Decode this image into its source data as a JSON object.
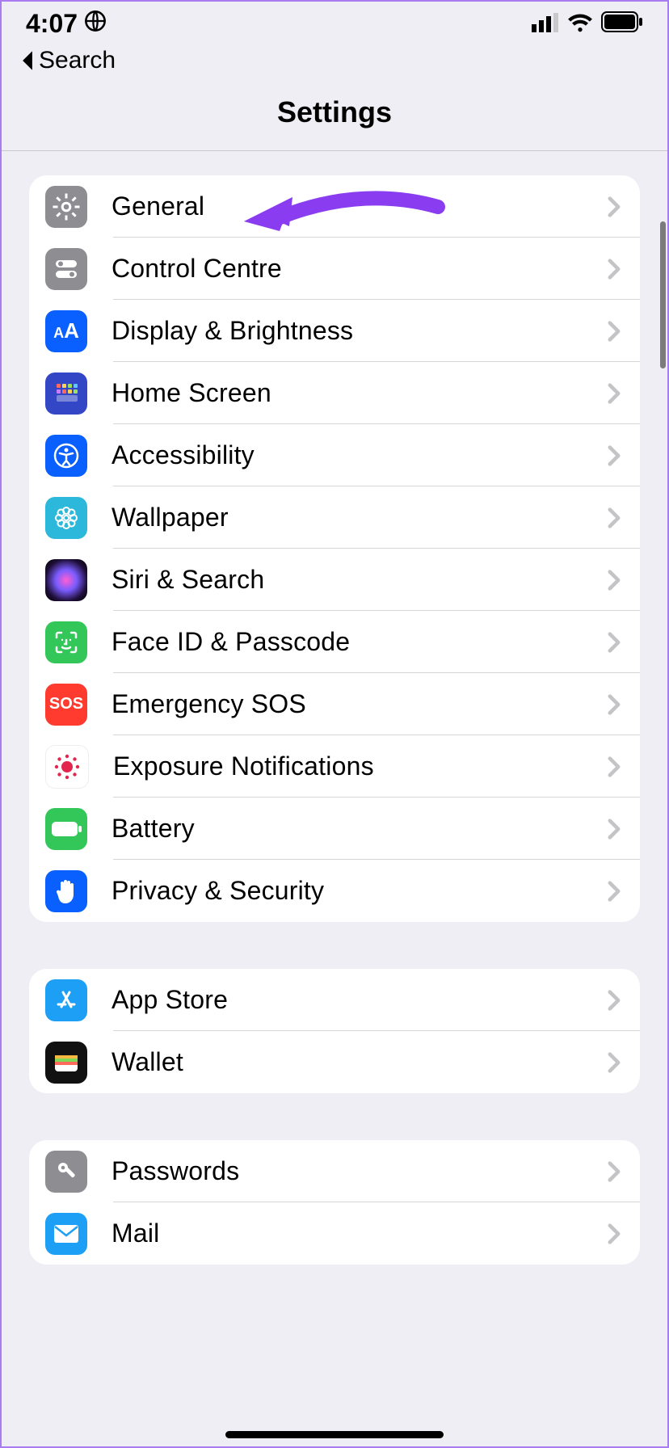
{
  "status": {
    "time": "4:07",
    "back_label": "Search"
  },
  "title": "Settings",
  "groups": [
    {
      "rows": [
        {
          "id": "general",
          "label": "General",
          "bg": "#8e8d92"
        },
        {
          "id": "control-centre",
          "label": "Control Centre",
          "bg": "#8e8d92"
        },
        {
          "id": "display-brightness",
          "label": "Display & Brightness",
          "bg": "#0a60ff"
        },
        {
          "id": "home-screen",
          "label": "Home Screen",
          "bg": "#3246c6"
        },
        {
          "id": "accessibility",
          "label": "Accessibility",
          "bg": "#0a60ff"
        },
        {
          "id": "wallpaper",
          "label": "Wallpaper",
          "bg": "#2cb8da"
        },
        {
          "id": "siri-search",
          "label": "Siri & Search",
          "bg": "#111"
        },
        {
          "id": "face-id-passcode",
          "label": "Face ID & Passcode",
          "bg": "#33c759"
        },
        {
          "id": "emergency-sos",
          "label": "Emergency SOS",
          "bg": "#ff3b30"
        },
        {
          "id": "exposure-notifications",
          "label": "Exposure Notifications",
          "bg": "#fff"
        },
        {
          "id": "battery",
          "label": "Battery",
          "bg": "#33c759"
        },
        {
          "id": "privacy-security",
          "label": "Privacy & Security",
          "bg": "#0a60ff"
        }
      ]
    },
    {
      "rows": [
        {
          "id": "app-store",
          "label": "App Store",
          "bg": "#1e9ff6"
        },
        {
          "id": "wallet",
          "label": "Wallet",
          "bg": "#111"
        }
      ]
    },
    {
      "rows": [
        {
          "id": "passwords",
          "label": "Passwords",
          "bg": "#8e8d92"
        },
        {
          "id": "mail",
          "label": "Mail",
          "bg": "#1e9ff6"
        }
      ]
    }
  ],
  "annotation": {
    "target": "general",
    "color": "#8a3cf0"
  }
}
